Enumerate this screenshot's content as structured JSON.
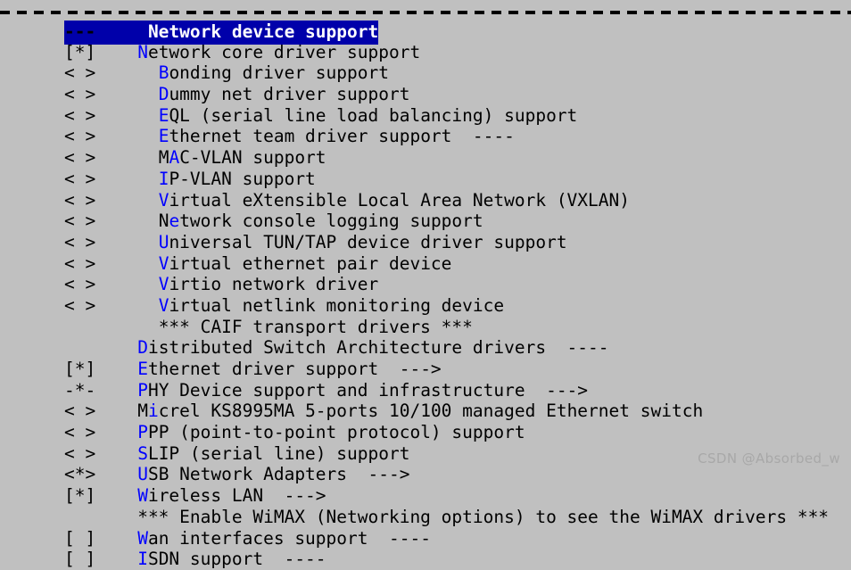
{
  "screen": {
    "kind": "linux-kernel-menuconfig",
    "background_color": "#c0c0c0",
    "text_color": "#000000",
    "hotkey_color": "#0000ff",
    "selection_bg_color": "#0000aa",
    "selection_fg_color": "#ffffff"
  },
  "frame": {
    "top_rule": "----------------------------------------------------------------------------"
  },
  "menu": {
    "rows": [
      {
        "marker": "---",
        "pre": "",
        "hot": "",
        "post": " Network device support",
        "indent": 0,
        "selected": true
      },
      {
        "marker": "[*]",
        "pre": "",
        "hot": "N",
        "post": "etwork core driver support",
        "indent": 0,
        "selected": false
      },
      {
        "marker": "< >",
        "pre": "",
        "hot": "B",
        "post": "onding driver support",
        "indent": 1,
        "selected": false
      },
      {
        "marker": "< >",
        "pre": "",
        "hot": "D",
        "post": "ummy net driver support",
        "indent": 1,
        "selected": false
      },
      {
        "marker": "< >",
        "pre": "",
        "hot": "E",
        "post": "QL (serial line load balancing) support",
        "indent": 1,
        "selected": false
      },
      {
        "marker": "< >",
        "pre": "",
        "hot": "E",
        "post": "thernet team driver support  ----",
        "indent": 1,
        "selected": false
      },
      {
        "marker": "< >",
        "pre": "M",
        "hot": "A",
        "post": "C-VLAN support",
        "indent": 1,
        "selected": false
      },
      {
        "marker": "< >",
        "pre": "",
        "hot": "I",
        "post": "P-VLAN support",
        "indent": 1,
        "selected": false
      },
      {
        "marker": "< >",
        "pre": "",
        "hot": "V",
        "post": "irtual eXtensible Local Area Network (VXLAN)",
        "indent": 1,
        "selected": false
      },
      {
        "marker": "< >",
        "pre": "N",
        "hot": "e",
        "post": "twork console logging support",
        "indent": 1,
        "selected": false
      },
      {
        "marker": "< >",
        "pre": "",
        "hot": "U",
        "post": "niversal TUN/TAP device driver support",
        "indent": 1,
        "selected": false
      },
      {
        "marker": "< >",
        "pre": "",
        "hot": "V",
        "post": "irtual ethernet pair device",
        "indent": 1,
        "selected": false
      },
      {
        "marker": "< >",
        "pre": "",
        "hot": "V",
        "post": "irtio network driver",
        "indent": 1,
        "selected": false
      },
      {
        "marker": "< >",
        "pre": "",
        "hot": "V",
        "post": "irtual netlink monitoring device",
        "indent": 1,
        "selected": false
      },
      {
        "marker": "   ",
        "pre": "*** CAIF transport drivers ***",
        "hot": "",
        "post": "",
        "indent": 1,
        "selected": false
      },
      {
        "marker": "   ",
        "pre": "",
        "hot": "D",
        "post": "istributed Switch Architecture drivers  ----",
        "indent": 0,
        "selected": false
      },
      {
        "marker": "[*]",
        "pre": "",
        "hot": "E",
        "post": "thernet driver support  --->",
        "indent": 0,
        "selected": false
      },
      {
        "marker": "-*-",
        "pre": "",
        "hot": "P",
        "post": "HY Device support and infrastructure  --->",
        "indent": 0,
        "selected": false
      },
      {
        "marker": "< >",
        "pre": "M",
        "hot": "i",
        "post": "crel KS8995MA 5-ports 10/100 managed Ethernet switch",
        "indent": 0,
        "selected": false
      },
      {
        "marker": "< >",
        "pre": "",
        "hot": "P",
        "post": "PP (point-to-point protocol) support",
        "indent": 0,
        "selected": false
      },
      {
        "marker": "< >",
        "pre": "",
        "hot": "S",
        "post": "LIP (serial line) support",
        "indent": 0,
        "selected": false
      },
      {
        "marker": "<*>",
        "pre": "",
        "hot": "U",
        "post": "SB Network Adapters  --->",
        "indent": 0,
        "selected": false
      },
      {
        "marker": "[*]",
        "pre": "",
        "hot": "W",
        "post": "ireless LAN  --->",
        "indent": 0,
        "selected": false
      },
      {
        "marker": "   ",
        "pre": "*** Enable WiMAX (Networking options) to see the WiMAX drivers ***",
        "hot": "",
        "post": "",
        "indent": 0,
        "selected": false
      },
      {
        "marker": "[ ]",
        "pre": "",
        "hot": "W",
        "post": "an interfaces support  ----",
        "indent": 0,
        "selected": false
      },
      {
        "marker": "[ ]",
        "pre": "",
        "hot": "I",
        "post": "SDN support  ----",
        "indent": 0,
        "selected": false
      }
    ]
  },
  "watermark": {
    "text": "CSDN @Absorbed_w"
  }
}
